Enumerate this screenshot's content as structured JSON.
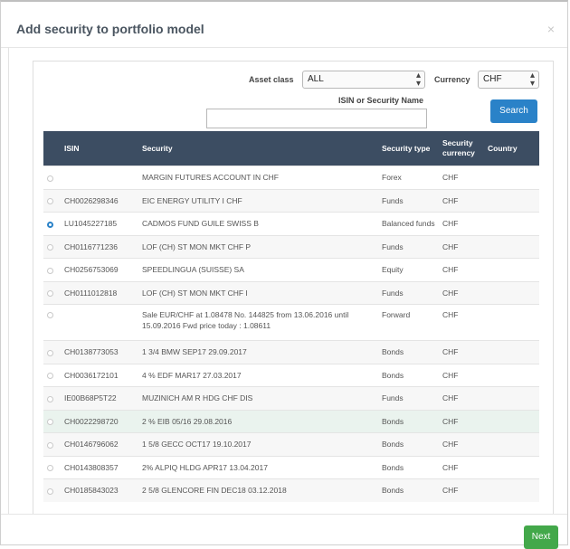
{
  "modal": {
    "title": "Add security to portfolio model",
    "close_label": "×",
    "next_label": "Next"
  },
  "filters": {
    "asset_class_label": "Asset class",
    "asset_class_value": "ALL",
    "currency_label": "Currency",
    "currency_value": "CHF",
    "search_label": "ISIN or Security Name",
    "search_value": "",
    "search_button": "Search"
  },
  "table": {
    "headers": {
      "isin": "ISIN",
      "security": "Security",
      "security_type": "Security type",
      "security_currency": "Security currency",
      "country": "Country"
    },
    "rows": [
      {
        "selected": false,
        "isin": "",
        "security": "MARGIN FUTURES ACCOUNT IN CHF",
        "type": "Forex",
        "currency": "CHF",
        "country": ""
      },
      {
        "selected": false,
        "isin": "CH0026298346",
        "security": "EIC ENERGY UTILITY I CHF",
        "type": "Funds",
        "currency": "CHF",
        "country": ""
      },
      {
        "selected": true,
        "isin": "LU1045227185",
        "security": "CADMOS FUND GUILE SWISS B",
        "type": "Balanced funds",
        "currency": "CHF",
        "country": ""
      },
      {
        "selected": false,
        "isin": "CH0116771236",
        "security": "LOF (CH) ST MON MKT CHF P",
        "type": "Funds",
        "currency": "CHF",
        "country": ""
      },
      {
        "selected": false,
        "isin": "CH0256753069",
        "security": "SPEEDLINGUA (SUISSE) SA",
        "type": "Equity",
        "currency": "CHF",
        "country": ""
      },
      {
        "selected": false,
        "isin": "CH0111012818",
        "security": "LOF (CH) ST MON MKT CHF I",
        "type": "Funds",
        "currency": "CHF",
        "country": ""
      },
      {
        "selected": false,
        "isin": "",
        "security": "Sale EUR/CHF at 1.08478 No. 144825 from 13.06.2016 until 15.09.2016 Fwd price today : 1.08611",
        "type": "Forward",
        "currency": "CHF",
        "country": ""
      },
      {
        "selected": false,
        "isin": "CH0138773053",
        "security": "1 3/4 BMW SEP17 29.09.2017",
        "type": "Bonds",
        "currency": "CHF",
        "country": ""
      },
      {
        "selected": false,
        "isin": "CH0036172101",
        "security": "4 % EDF MAR17 27.03.2017",
        "type": "Bonds",
        "currency": "CHF",
        "country": ""
      },
      {
        "selected": false,
        "isin": "IE00B68P5T22",
        "security": "MUZINICH AM R HDG CHF DIS",
        "type": "Funds",
        "currency": "CHF",
        "country": ""
      },
      {
        "selected": false,
        "isin": "CH0022298720",
        "security": "2 % EIB 05/16 29.08.2016",
        "type": "Bonds",
        "currency": "CHF",
        "country": ""
      },
      {
        "selected": false,
        "isin": "CH0146796062",
        "security": "1 5/8 GECC OCT17 19.10.2017",
        "type": "Bonds",
        "currency": "CHF",
        "country": ""
      },
      {
        "selected": false,
        "isin": "CH0143808357",
        "security": "2% ALPIQ HLDG APR17 13.04.2017",
        "type": "Bonds",
        "currency": "CHF",
        "country": ""
      },
      {
        "selected": false,
        "isin": "CH0185843023",
        "security": "2 5/8 GLENCORE FIN DEC18 03.12.2018",
        "type": "Bonds",
        "currency": "CHF",
        "country": ""
      }
    ]
  },
  "colors": {
    "header_bg": "#3c4d62",
    "primary": "#2a82c8",
    "success": "#43a84a"
  }
}
